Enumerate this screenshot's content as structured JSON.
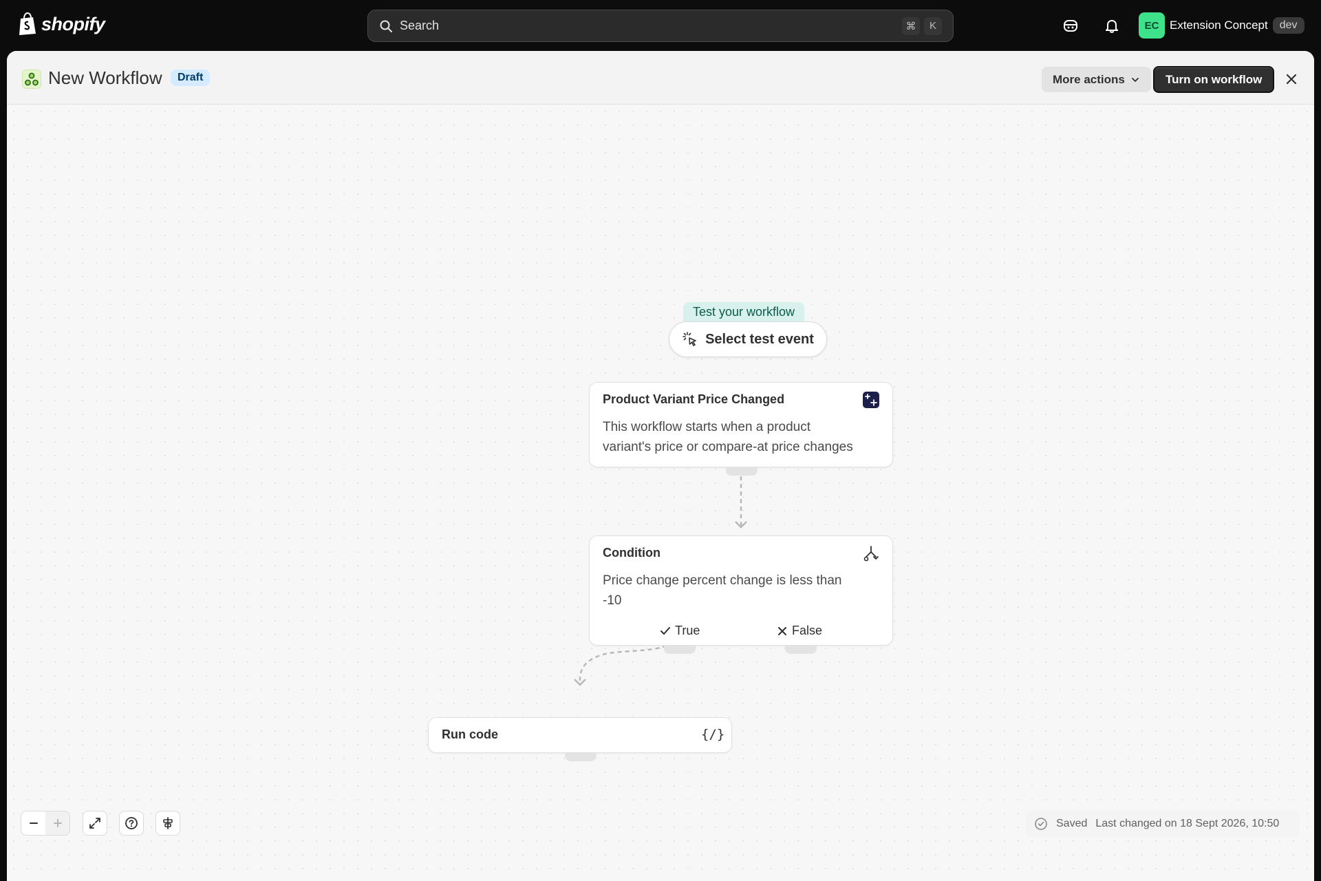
{
  "topbar": {
    "brand": "shopify",
    "search_placeholder": "Search",
    "shortcut_cmd": "⌘",
    "shortcut_key": "K",
    "store_initials": "EC",
    "store_name": "Extension Concept",
    "store_badge": "dev"
  },
  "header": {
    "title": "New Workflow",
    "status": "Draft",
    "more_actions": "More actions",
    "primary_action": "Turn on workflow"
  },
  "canvas": {
    "test_label": "Test your workflow",
    "select_test_event": "Select test event",
    "trigger": {
      "title": "Product Variant Price Changed",
      "description_line1": "This workflow starts when a product",
      "description_line2": "variant's price or compare-at price changes"
    },
    "condition": {
      "title": "Condition",
      "description_line1": "Price change percent change is less than",
      "description_line2": "-10",
      "true_label": "True",
      "false_label": "False"
    },
    "action": {
      "title": "Run code",
      "icon_text": "{/}"
    }
  },
  "footer": {
    "saved": "Saved",
    "last_changed": "Last changed on 18 Sept 2026, 10:50"
  },
  "colors": {
    "accent_green": "#3ee28a",
    "draft_blue": "#d5ebff",
    "test_teal": "#d8f1ec",
    "primary_dark": "#303030"
  }
}
